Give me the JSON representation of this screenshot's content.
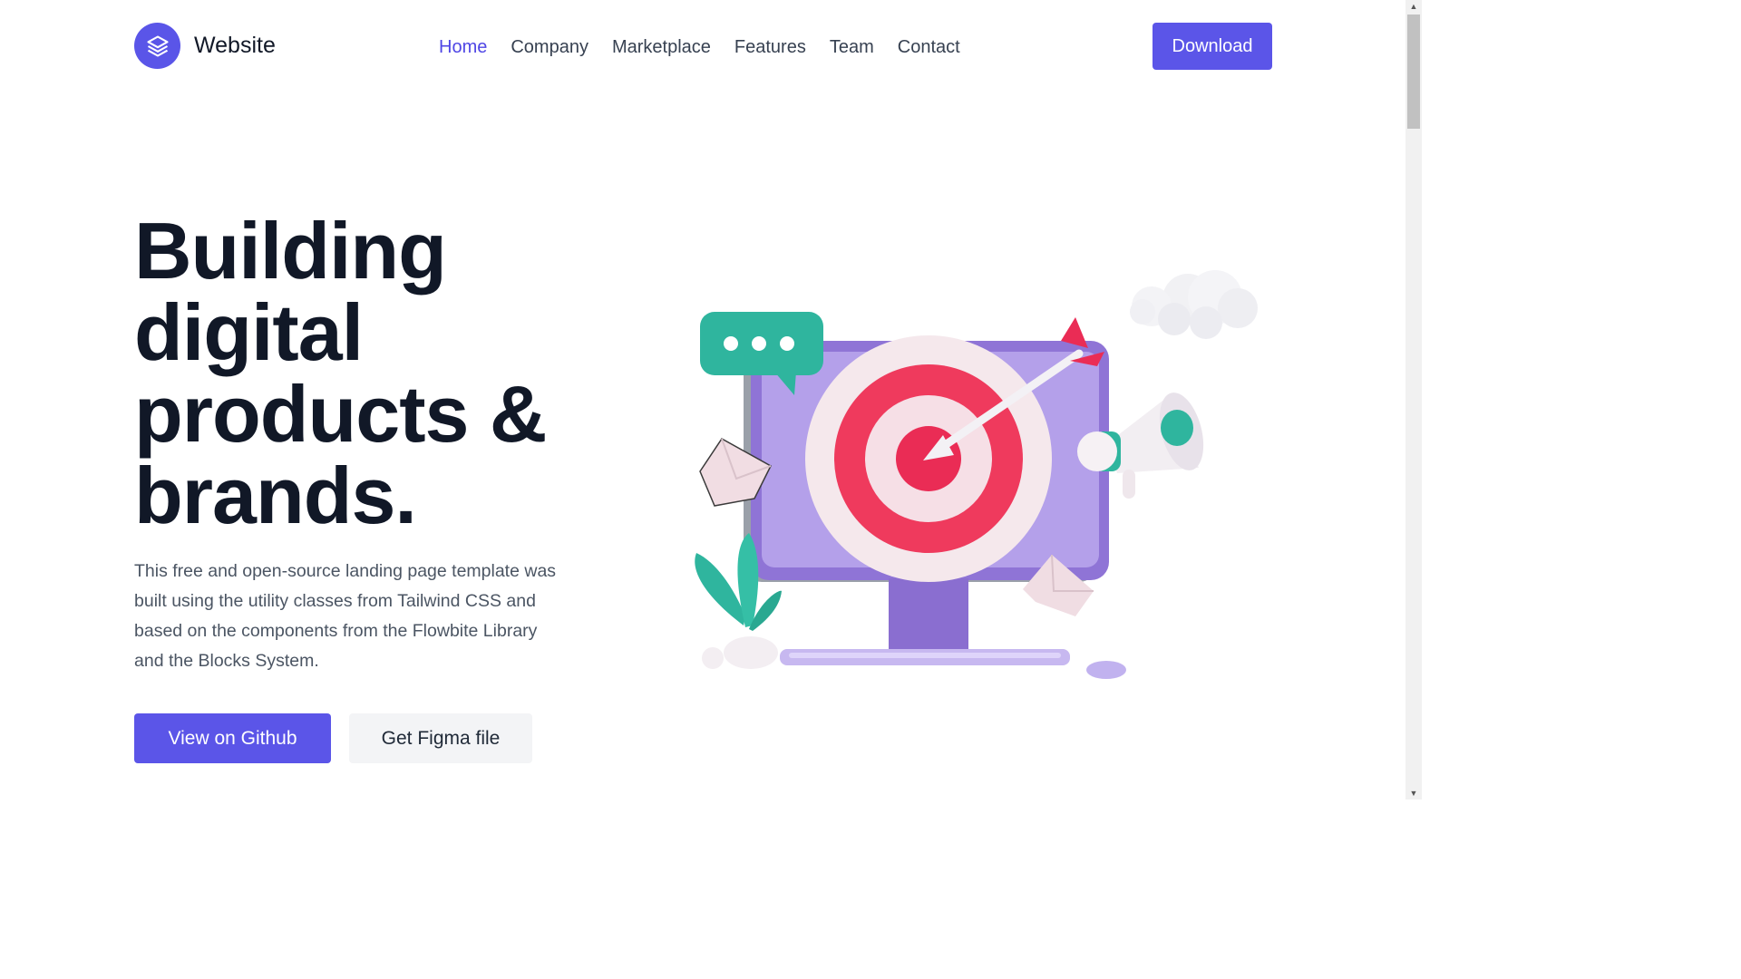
{
  "header": {
    "brand": "Website",
    "nav": [
      {
        "label": "Home",
        "active": true
      },
      {
        "label": "Company"
      },
      {
        "label": "Marketplace"
      },
      {
        "label": "Features"
      },
      {
        "label": "Team"
      },
      {
        "label": "Contact"
      }
    ],
    "download_label": "Download"
  },
  "hero": {
    "title_lines": [
      "Building",
      "digital",
      "products &",
      "brands."
    ],
    "description": "This free and open-source landing page template was built using the utility classes from Tailwind CSS and based on the components from the Flowbite Library and the Blocks System.",
    "primary_button": "View on Github",
    "secondary_button": "Get Figma file"
  },
  "colors": {
    "accent": "#5b55e8",
    "active_nav": "#4f46e5",
    "heading": "#111827",
    "body_text": "#4b5563"
  }
}
